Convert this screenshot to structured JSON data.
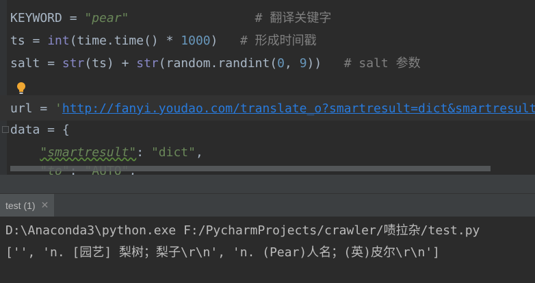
{
  "editor": {
    "line1": {
      "var": "KEYWORD",
      "op": " = ",
      "str": "\"pear\"",
      "pad": "                 ",
      "comment": "# 翻译关键字"
    },
    "line2": {
      "var": "ts",
      "op": " = ",
      "fn": "int",
      "args_open": "(time.time() * ",
      "num": "1000",
      "close": ")",
      "pad": "   ",
      "comment": "# 形成时间戳"
    },
    "line3": {
      "var": "salt",
      "op": " = ",
      "fn1": "str",
      "a1": "(ts) + ",
      "fn2": "str",
      "a2": "(random.randint(",
      "n1": "0",
      "sep": ", ",
      "n2": "9",
      "close": "))",
      "pad": "   ",
      "comment": "# salt 参数"
    },
    "line5": {
      "var": "url",
      "op": " = ",
      "q": "'",
      "url": "http://fanyi.youdao.com/translate_o?smartresult=dict&smartresult=rule"
    },
    "line6": {
      "text": "data = {"
    },
    "line7": {
      "indent": "    ",
      "key": "\"smartresult\"",
      "colon": ": ",
      "val": "\"dict\"",
      "comma": ","
    },
    "line8": {
      "indent": "    ",
      "key": "\"to\"",
      "colon": ": ",
      "val": "\"AUTO\"",
      "comma": ","
    }
  },
  "run_panel": {
    "tab_label": "test (1)",
    "close_glyph": "✕"
  },
  "console": {
    "command": "D:\\Anaconda3\\python.exe F:/PycharmProjects/crawler/啧拉杂/test.py",
    "output": "['', 'n. [园艺] 梨树；梨子\\r\\n', 'n. (Pear)人名；(英)皮尔\\r\\n']"
  },
  "colors": {
    "background": "#2b2b2b",
    "string": "#6a8759",
    "number": "#6897bb",
    "comment": "#808080",
    "builtin": "#8888c6",
    "url": "#287bde",
    "bulb": "#f0a732"
  }
}
